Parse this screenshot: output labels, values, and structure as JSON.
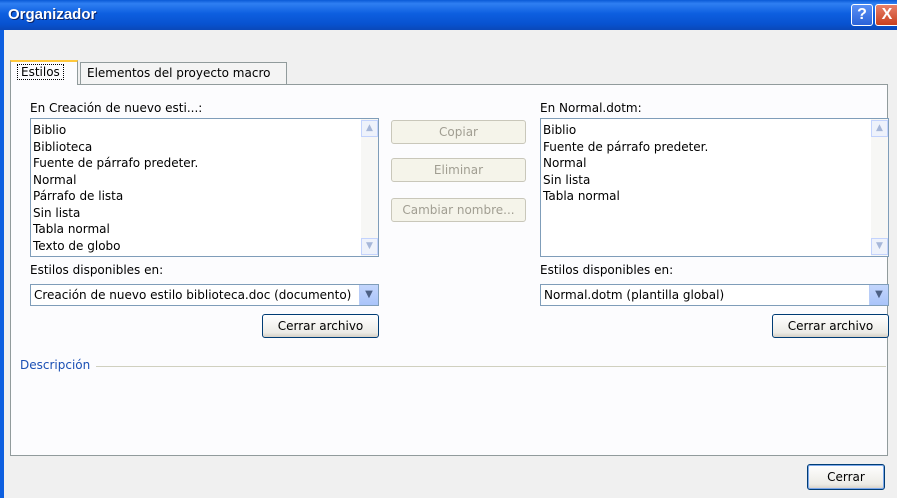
{
  "window": {
    "title": "Organizador"
  },
  "titlebar_buttons": {
    "help": "?",
    "close": "X"
  },
  "tabs": [
    {
      "label": "Estilos"
    },
    {
      "label": "Elementos del proyecto macro"
    }
  ],
  "left": {
    "list_label": "En Creación de nuevo esti...:",
    "items": [
      "Biblio",
      "Biblioteca",
      "Fuente de párrafo predeter.",
      "Normal",
      "Párrafo de lista",
      "Sin lista",
      "Tabla normal",
      "Texto de globo"
    ],
    "available_label": "Estilos disponibles en:",
    "available_value": "Creación de nuevo estilo biblioteca.doc (documento)",
    "close_file_label": "Cerrar archivo"
  },
  "middle": {
    "copy_label": "Copiar",
    "delete_label": "Eliminar",
    "rename_label": "Cambiar nombre..."
  },
  "right": {
    "list_label": "En Normal.dotm:",
    "items": [
      "Biblio",
      "Fuente de párrafo predeter.",
      "Normal",
      "Sin lista",
      "Tabla normal"
    ],
    "available_label": "Estilos disponibles en:",
    "available_value": "Normal.dotm (plantilla global)",
    "close_file_label": "Cerrar archivo"
  },
  "description_label": "Descripción",
  "close_label": "Cerrar",
  "icons": {
    "scroll_up": "▲",
    "scroll_down": "▼",
    "dropdown": "▼"
  }
}
